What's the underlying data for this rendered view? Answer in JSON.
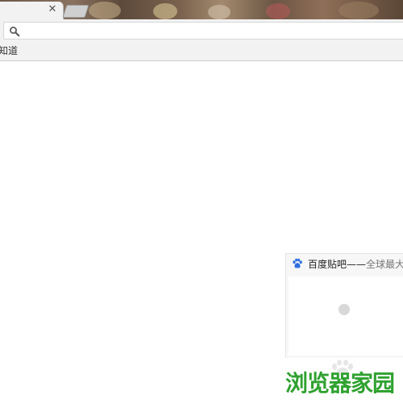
{
  "browser": {
    "tab": {
      "close_glyph": "✕"
    },
    "omnibox": {
      "value": "",
      "placeholder": ""
    },
    "icons": {
      "search": "search-icon",
      "close": "close-icon",
      "new_tab": "new-tab-icon",
      "paw": "baidu-paw-icon"
    }
  },
  "bookmarks": {
    "items": [
      {
        "label": "知道"
      }
    ]
  },
  "most_visited": {
    "tiles": [
      {
        "title": "百度贴吧——",
        "title_faded": "全球最大的"
      }
    ]
  },
  "watermark": {
    "text": "浏览器家园",
    "color": "#2fa12f"
  }
}
